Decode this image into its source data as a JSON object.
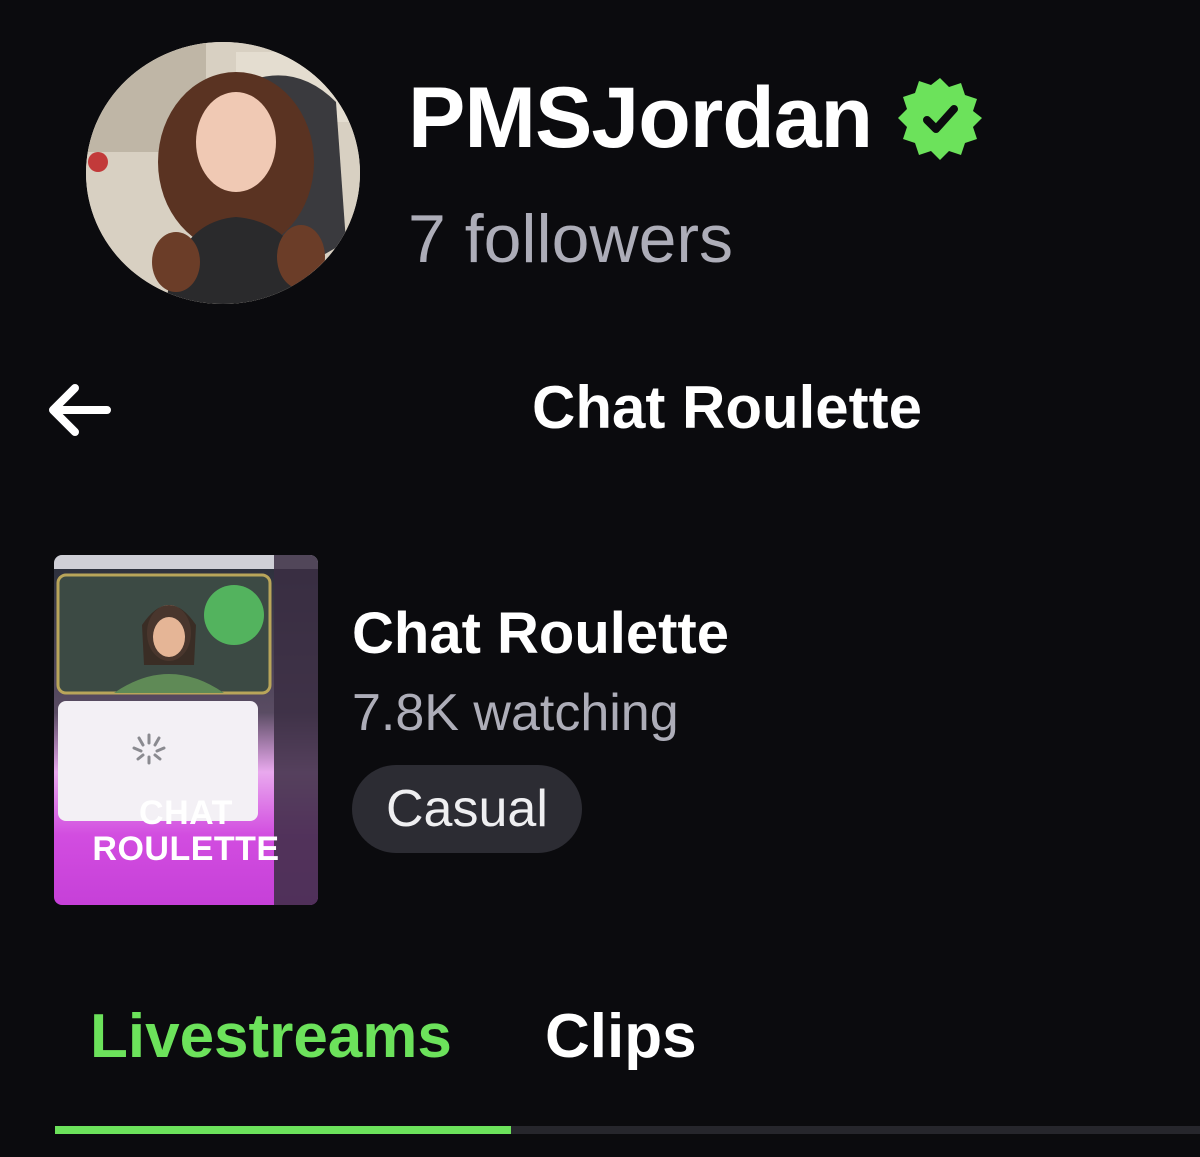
{
  "profile": {
    "username": "PMSJordan",
    "followers": "7 followers",
    "verified_icon": "verified-badge-icon",
    "accent_color": "#6ce25b"
  },
  "nav": {
    "back_icon": "arrow-left-icon",
    "title": "Chat Roulette"
  },
  "category": {
    "thumbnail_text_line1": "CHAT",
    "thumbnail_text_line2": "ROULETTE",
    "title": "Chat Roulette",
    "viewers": "7.8K watching",
    "tag": "Casual"
  },
  "tabs": [
    {
      "label": "Livestreams",
      "active": true
    },
    {
      "label": "Clips",
      "active": false
    }
  ]
}
